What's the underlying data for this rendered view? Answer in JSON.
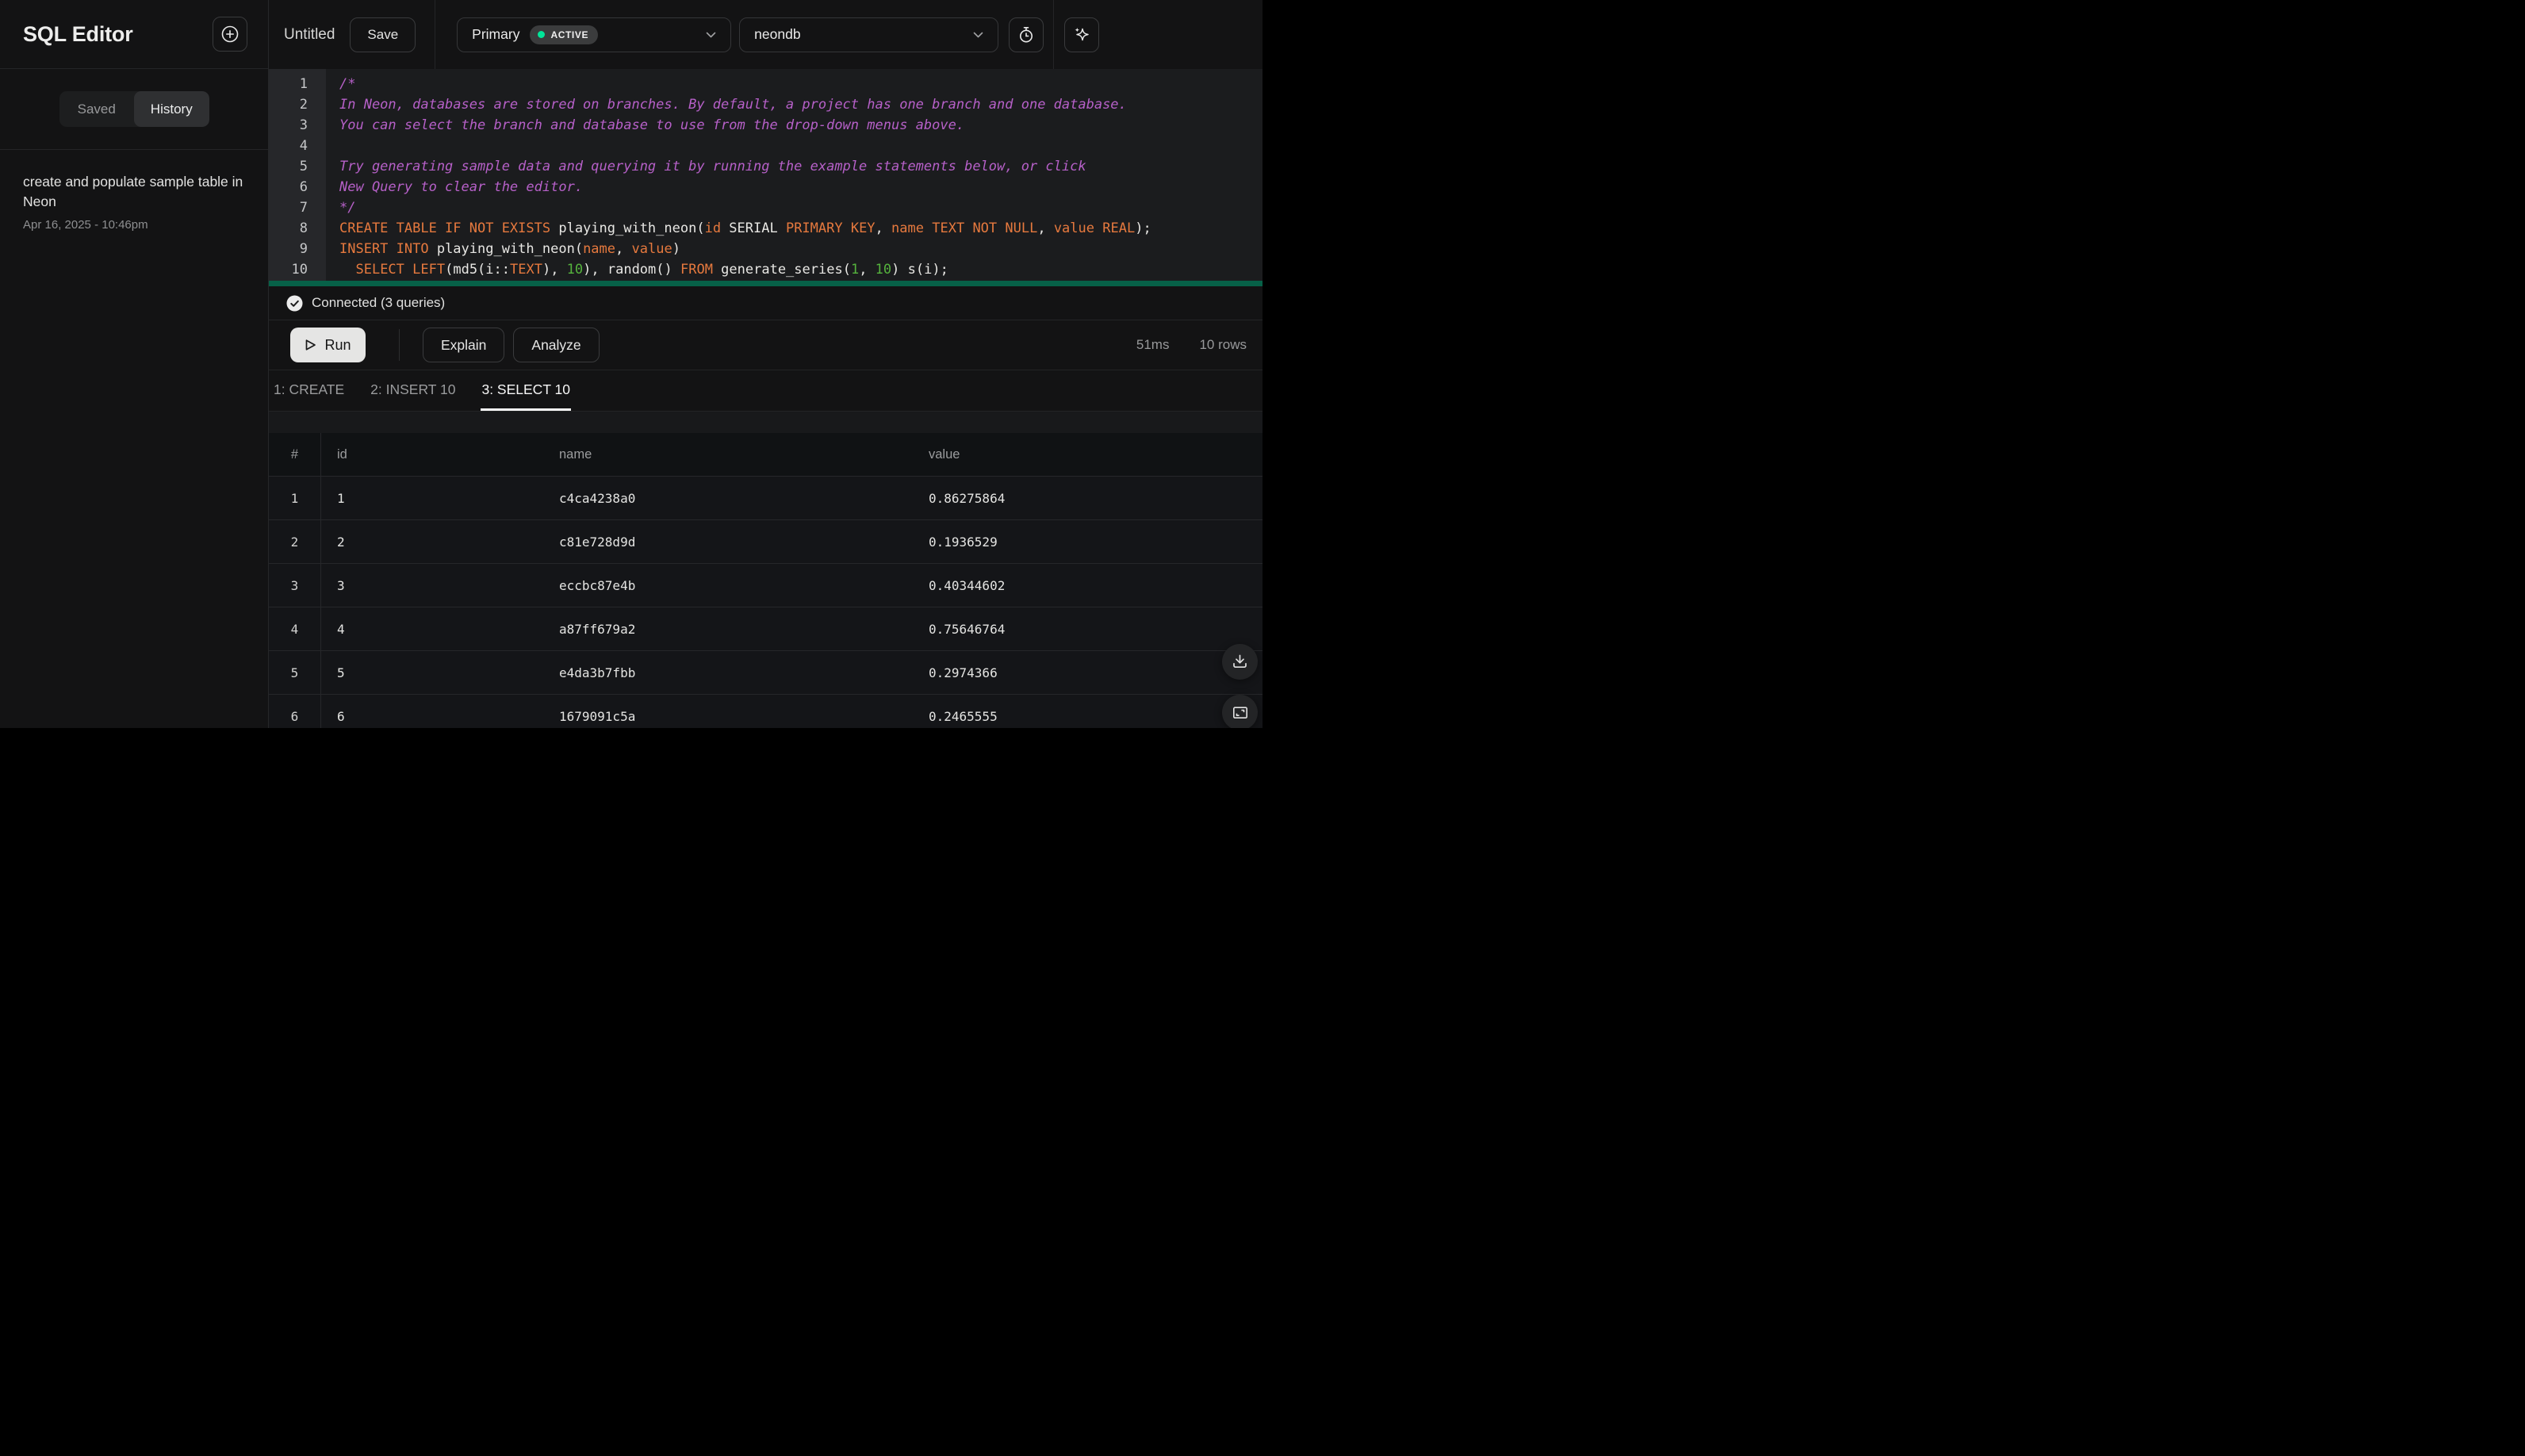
{
  "sidebar": {
    "title": "SQL Editor",
    "tabs": [
      {
        "label": "Saved",
        "active": false
      },
      {
        "label": "History",
        "active": true
      }
    ],
    "history_items": [
      {
        "title": "create and populate sample table in Neon",
        "timestamp": "Apr 16, 2025 - 10:46pm"
      }
    ]
  },
  "topbar": {
    "query_title": "Untitled",
    "save_label": "Save",
    "branch": {
      "label": "Primary",
      "status": "ACTIVE",
      "status_color": "#00e599"
    },
    "database": {
      "label": "neondb"
    }
  },
  "editor": {
    "statement_highlight_color": "#076148",
    "lines": [
      {
        "n": "1",
        "seg": [
          [
            "c",
            "/*"
          ]
        ]
      },
      {
        "n": "2",
        "seg": [
          [
            "c",
            "In Neon, databases are stored on branches. By default, a project has one branch and one database."
          ]
        ]
      },
      {
        "n": "3",
        "seg": [
          [
            "c",
            "You can select the branch and database to use from the drop-down menus above."
          ]
        ]
      },
      {
        "n": "4",
        "seg": []
      },
      {
        "n": "5",
        "seg": [
          [
            "c",
            "Try generating sample data and querying it by running the example statements below, or click"
          ]
        ]
      },
      {
        "n": "6",
        "seg": [
          [
            "c",
            "New Query to clear the editor."
          ]
        ]
      },
      {
        "n": "7",
        "seg": [
          [
            "c",
            "*/"
          ]
        ]
      },
      {
        "n": "8",
        "seg": [
          [
            "k",
            "CREATE TABLE IF NOT EXISTS"
          ],
          [
            "p",
            " playing_with_neon("
          ],
          [
            "k",
            "id"
          ],
          [
            "p",
            " SERIAL "
          ],
          [
            "k",
            "PRIMARY KEY"
          ],
          [
            "p",
            ", "
          ],
          [
            "k",
            "name"
          ],
          [
            "p",
            " "
          ],
          [
            "k",
            "TEXT"
          ],
          [
            "p",
            " "
          ],
          [
            "k",
            "NOT NULL"
          ],
          [
            "p",
            ", "
          ],
          [
            "k",
            "value"
          ],
          [
            "p",
            " "
          ],
          [
            "k",
            "REAL"
          ],
          [
            "p",
            ");"
          ]
        ]
      },
      {
        "n": "9",
        "seg": [
          [
            "k",
            "INSERT INTO"
          ],
          [
            "p",
            " playing_with_neon("
          ],
          [
            "k",
            "name"
          ],
          [
            "p",
            ", "
          ],
          [
            "k",
            "value"
          ],
          [
            "p",
            ")"
          ]
        ]
      },
      {
        "n": "10",
        "seg": [
          [
            "p",
            "  "
          ],
          [
            "k",
            "SELECT"
          ],
          [
            "p",
            " "
          ],
          [
            "k",
            "LEFT"
          ],
          [
            "p",
            "(md5(i::"
          ],
          [
            "k",
            "TEXT"
          ],
          [
            "p",
            "), "
          ],
          [
            "num",
            "10"
          ],
          [
            "p",
            "), random() "
          ],
          [
            "k",
            "FROM"
          ],
          [
            "p",
            " generate_series("
          ],
          [
            "num",
            "1"
          ],
          [
            "p",
            ", "
          ],
          [
            "num",
            "10"
          ],
          [
            "p",
            ") s(i);"
          ]
        ]
      }
    ]
  },
  "status": {
    "connected": "Connected (3 queries)"
  },
  "actions": {
    "run": "Run",
    "explain": "Explain",
    "analyze": "Analyze",
    "duration": "51ms",
    "row_count": "10 rows"
  },
  "results": {
    "tabs": [
      {
        "label": "1: CREATE",
        "active": false
      },
      {
        "label": "2: INSERT 10",
        "active": false
      },
      {
        "label": "3: SELECT 10",
        "active": true
      }
    ],
    "columns": [
      "#",
      "id",
      "name",
      "value"
    ],
    "rows": [
      [
        "1",
        "1",
        "c4ca4238a0",
        "0.86275864"
      ],
      [
        "2",
        "2",
        "c81e728d9d",
        "0.1936529"
      ],
      [
        "3",
        "3",
        "eccbc87e4b",
        "0.40344602"
      ],
      [
        "4",
        "4",
        "a87ff679a2",
        "0.75646764"
      ],
      [
        "5",
        "5",
        "e4da3b7fbb",
        "0.2974366"
      ],
      [
        "6",
        "6",
        "1679091c5a",
        "0.2465555"
      ]
    ]
  },
  "icons": [
    "plus-circle",
    "chevron-down",
    "stopwatch",
    "sparkle",
    "check-circle",
    "play",
    "download",
    "expand"
  ],
  "colors": {
    "accent_green": "#00e599",
    "keyword_orange": "#e6793e",
    "comment_purple": "#b660c8",
    "number_green": "#55b33d"
  }
}
